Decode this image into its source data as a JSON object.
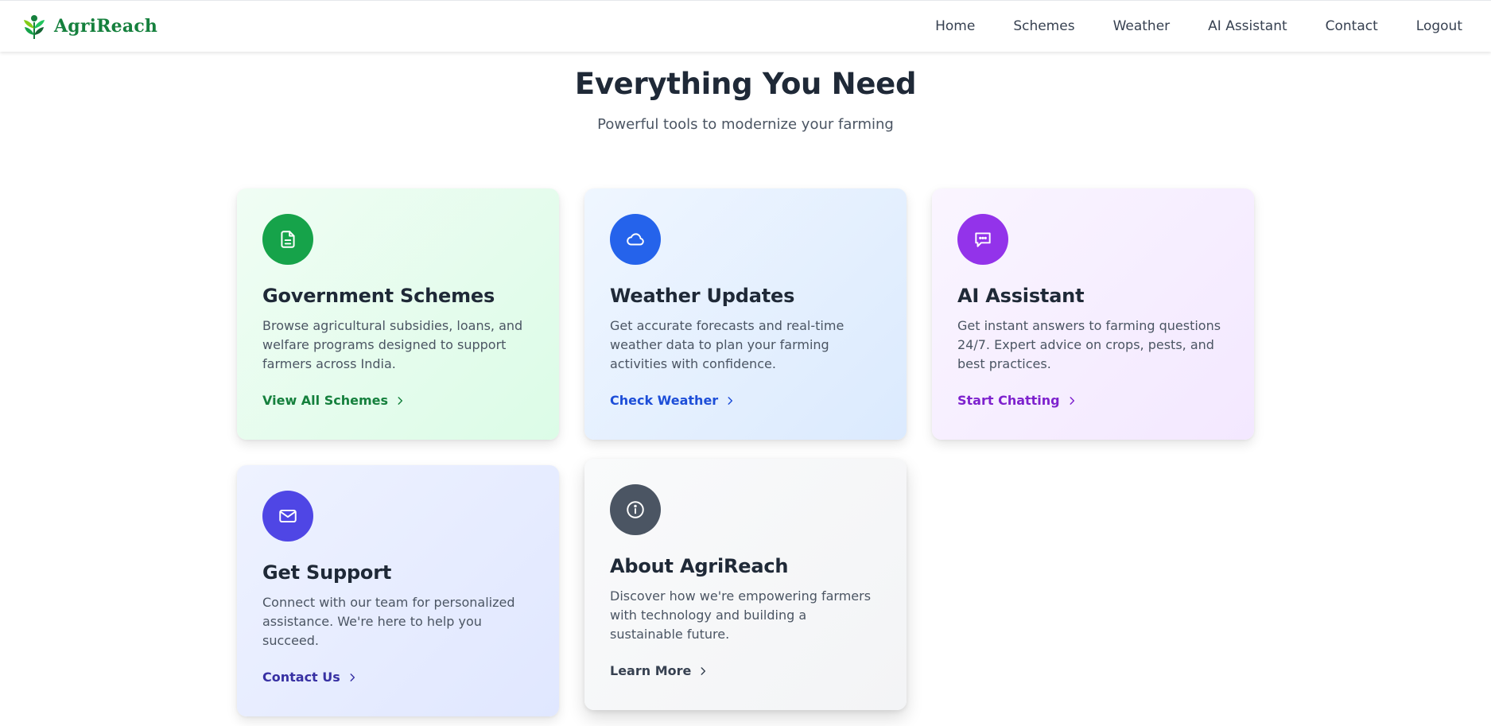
{
  "app": {
    "brand_name": "AgriReach",
    "brand_color": "#15803d"
  },
  "nav": {
    "items": [
      {
        "label": "Home"
      },
      {
        "label": "Schemes"
      },
      {
        "label": "Weather"
      },
      {
        "label": "AI Assistant"
      },
      {
        "label": "Contact"
      },
      {
        "label": "Logout"
      }
    ]
  },
  "hero": {
    "title": "Everything You Need",
    "subtitle": "Powerful tools to modernize your farming"
  },
  "cards": [
    {
      "icon": "document-icon",
      "accent": "#16a34a",
      "title": "Government Schemes",
      "description": "Browse agricultural subsidies, loans, and welfare programs designed to support farmers across India.",
      "link_label": "View All Schemes"
    },
    {
      "icon": "cloud-icon",
      "accent": "#2563eb",
      "title": "Weather Updates",
      "description": "Get accurate forecasts and real-time weather data to plan your farming activities with confidence.",
      "link_label": "Check Weather"
    },
    {
      "icon": "chat-icon",
      "accent": "#9333ea",
      "title": "AI Assistant",
      "description": "Get instant answers to farming questions 24/7. Expert advice on crops, pests, and best practices.",
      "link_label": "Start Chatting"
    },
    {
      "icon": "mail-icon",
      "accent": "#4f46e5",
      "title": "Get Support",
      "description": "Connect with our team for personalized assistance. We're here to help you succeed.",
      "link_label": "Contact Us"
    },
    {
      "icon": "info-icon",
      "accent": "#4b5563",
      "title": "About AgriReach",
      "description": "Discover how we're empowering farmers with technology and building a sustainable future.",
      "link_label": "Learn More"
    }
  ]
}
